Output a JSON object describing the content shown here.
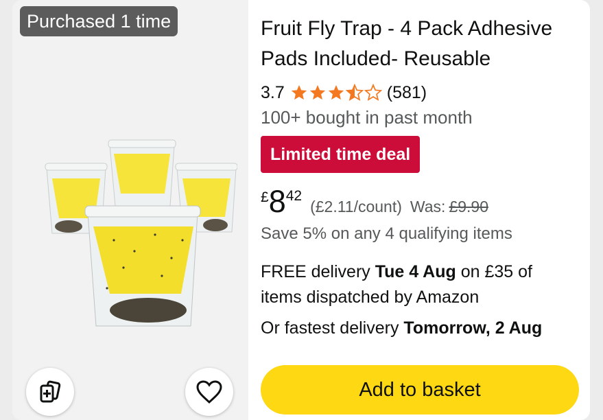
{
  "badge": {
    "label": "Purchased 1 time"
  },
  "product": {
    "title": "Fruit Fly Trap - 4 Pack Adhesive Pads Included- Reusable",
    "image_alt": "four clear fruit fly trap cups with yellow sticky pads",
    "rating": {
      "value": "3.7",
      "stars": 3.7,
      "count": "(581)"
    },
    "bought": "100+ bought in past month",
    "deal": "Limited time deal",
    "price": {
      "currency": "£",
      "whole": "8",
      "fraction": "42",
      "unit_price": "(£2.11/count)",
      "was_label": "Was:",
      "was_price": "£9.90"
    },
    "save": "Save 5% on any 4 qualifying items",
    "delivery": {
      "prefix": "FREE delivery ",
      "date": "Tue 4 Aug",
      "suffix": " on £35 of items dispatched by Amazon"
    },
    "fastest": {
      "prefix": "Or fastest delivery ",
      "date": "Tomorrow, 2 Aug"
    }
  },
  "actions": {
    "add_to_basket": "Add to basket",
    "compare_icon": "compare-cards-icon",
    "wishlist_icon": "heart-icon"
  },
  "colors": {
    "star": "#f3781f",
    "deal": "#cc0c39",
    "button": "#ffd814",
    "badge": "#5c5c5c"
  }
}
